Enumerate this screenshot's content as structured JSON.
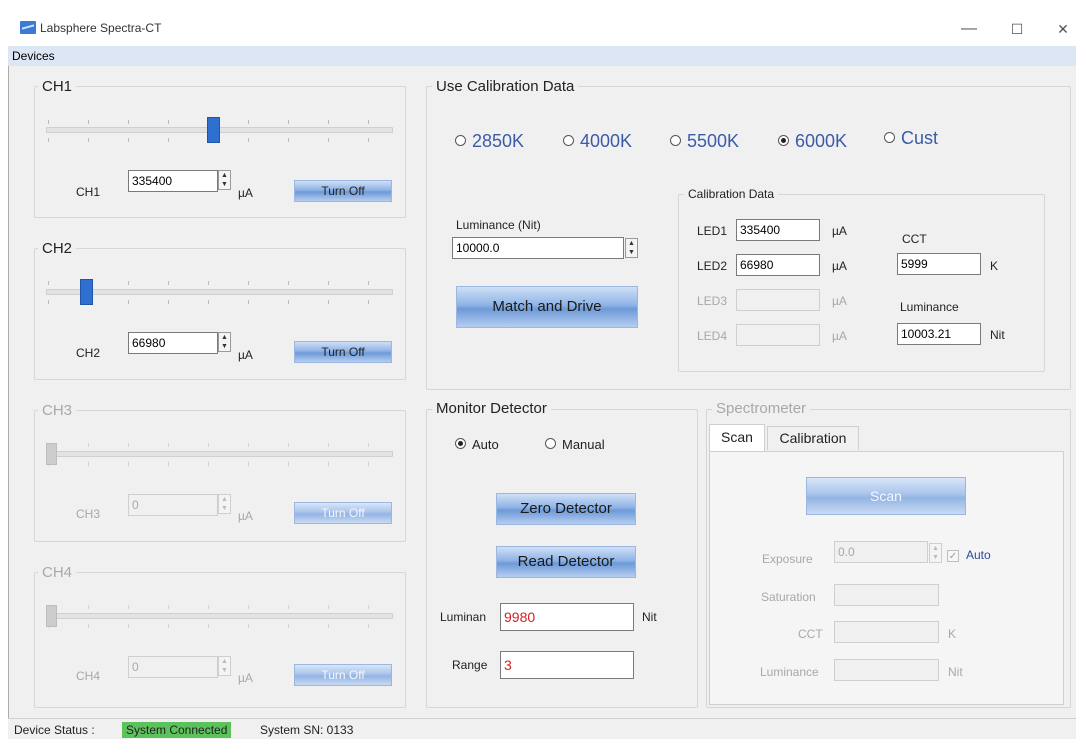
{
  "window": {
    "title": "Labsphere Spectra-CT",
    "controls": {
      "minimize": "—",
      "maximize": "☐",
      "close": "✕"
    }
  },
  "menu": {
    "devices": "Devices"
  },
  "channels": [
    {
      "group_label": "CH1",
      "label": "CH1",
      "value": "335400",
      "unit": "µA",
      "button": "Turn Off",
      "enabled": true,
      "level": 0.48
    },
    {
      "group_label": "CH2",
      "label": "CH2",
      "value": "66980",
      "unit": "µA",
      "button": "Turn Off",
      "enabled": true,
      "level": 0.1
    },
    {
      "group_label": "CH3",
      "label": "CH3",
      "value": "0",
      "unit": "µA",
      "button": "Turn Off",
      "enabled": false,
      "level": 0.0
    },
    {
      "group_label": "CH4",
      "label": "CH4",
      "value": "0",
      "unit": "µA",
      "button": "Turn Off",
      "enabled": false,
      "level": 0.0
    }
  ],
  "calibration": {
    "group_label": "Use Calibration Data",
    "options": [
      {
        "label": "2850K",
        "selected": false
      },
      {
        "label": "4000K",
        "selected": false
      },
      {
        "label": "5500K",
        "selected": false
      },
      {
        "label": "6000K",
        "selected": true
      },
      {
        "label": "Cust",
        "selected": false
      }
    ],
    "luminance_label": "Luminance (Nit)",
    "luminance_value": "10000.0",
    "match_button": "Match and Drive",
    "data": {
      "group_label": "Calibration Data",
      "leds": [
        {
          "label": "LED1",
          "value": "335400",
          "unit": "µA",
          "enabled": true
        },
        {
          "label": "LED2",
          "value": "66980",
          "unit": "µA",
          "enabled": true
        },
        {
          "label": "LED3",
          "value": "",
          "unit": "µA",
          "enabled": false
        },
        {
          "label": "LED4",
          "value": "",
          "unit": "µA",
          "enabled": false
        }
      ],
      "cct_label": "CCT",
      "cct_value": "5999",
      "cct_unit": "K",
      "lum_label": "Luminance",
      "lum_value": "10003.21",
      "lum_unit": "Nit"
    }
  },
  "monitor": {
    "group_label": "Monitor Detector",
    "auto_label": "Auto",
    "manual_label": "Manual",
    "mode": "Auto",
    "zero_button": "Zero Detector",
    "read_button": "Read Detector",
    "luminan_label": "Luminan",
    "luminan_value": "9980",
    "luminan_unit": "Nit",
    "range_label": "Range",
    "range_value": "3"
  },
  "spectrometer": {
    "group_label": "Spectrometer",
    "tabs": [
      "Scan",
      "Calibration"
    ],
    "active_tab": "Scan",
    "scan_button": "Scan",
    "exposure_label": "Exposure",
    "exposure_value": "0.0",
    "auto_label": "Auto",
    "auto_checked": true,
    "saturation_label": "Saturation",
    "cct_label": "CCT",
    "cct_unit": "K",
    "luminance_label": "Luminance",
    "luminance_unit": "Nit"
  },
  "status": {
    "device_label": "Device Status :",
    "connected": "System Connected",
    "connected_color": "#5cc35c",
    "sn": "System SN: 0133"
  }
}
